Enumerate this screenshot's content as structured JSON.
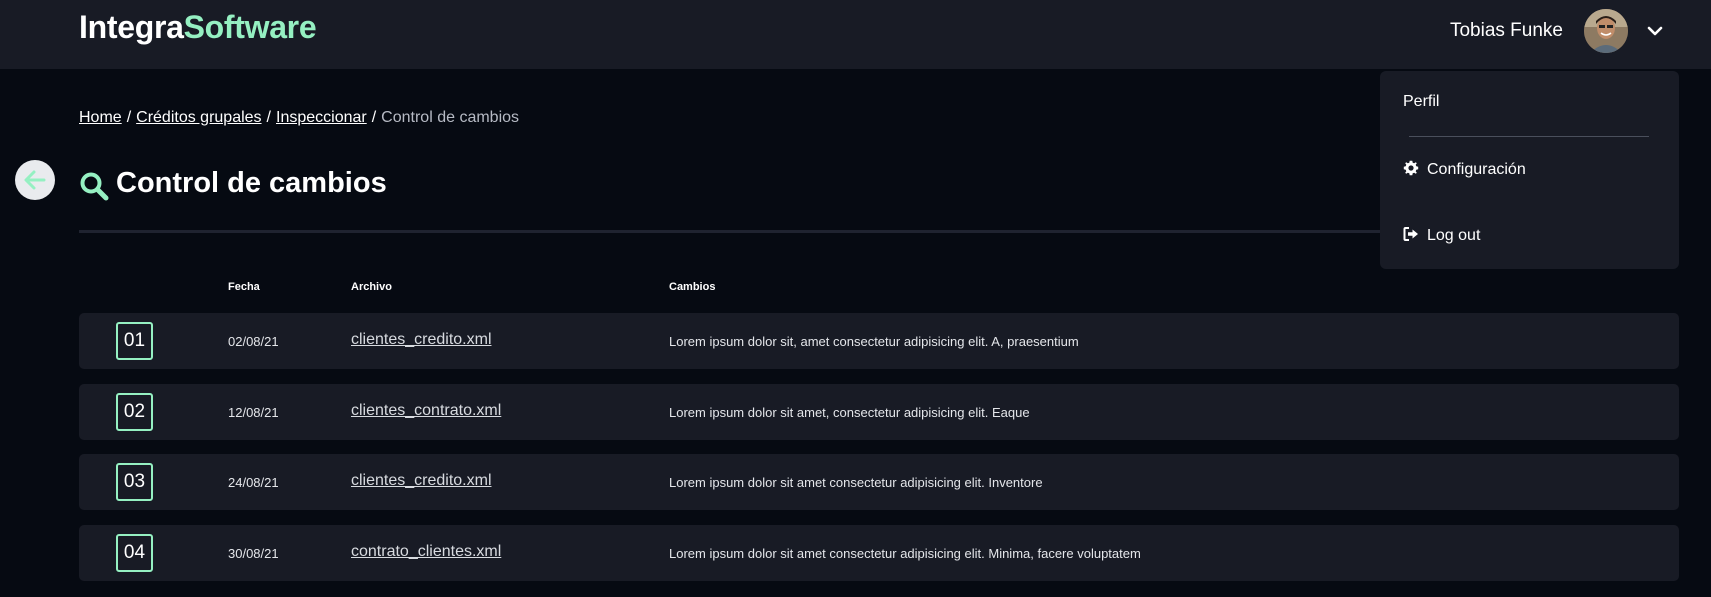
{
  "header": {
    "logo_part1": "Integra",
    "logo_part2": "Software",
    "user_name": "Tobias Funke"
  },
  "breadcrumb": {
    "items": [
      "Home",
      "Créditos grupales",
      "Inspeccionar"
    ],
    "current": "Control de cambios",
    "separator": "/"
  },
  "page": {
    "title": "Control de cambios"
  },
  "table": {
    "headers": {
      "fecha": "Fecha",
      "archivo": "Archivo",
      "cambios": "Cambios"
    },
    "rows": [
      {
        "num": "01",
        "fecha": "02/08/21",
        "archivo": "clientes_credito.xml",
        "cambios": "Lorem ipsum dolor sit, amet consectetur adipisicing elit. A, praesentium"
      },
      {
        "num": "02",
        "fecha": "12/08/21",
        "archivo": "clientes_contrato.xml",
        "cambios": "Lorem ipsum dolor sit amet, consectetur adipisicing elit. Eaque"
      },
      {
        "num": "03",
        "fecha": "24/08/21",
        "archivo": "clientes_credito.xml",
        "cambios": "Lorem ipsum dolor sit amet consectetur adipisicing elit. Inventore"
      },
      {
        "num": "04",
        "fecha": "30/08/21",
        "archivo": "contrato_clientes.xml",
        "cambios": "Lorem ipsum dolor sit amet consectetur adipisicing elit. Minima, facere voluptatem"
      }
    ]
  },
  "user_menu": {
    "perfil": "Perfil",
    "configuracion": "Configuración",
    "logout": "Log out"
  },
  "icons": {
    "back": "arrow-left-icon",
    "title": "search-icon",
    "menu_toggle": "chevron-down-icon",
    "settings": "gear-icon",
    "logout": "logout-icon"
  },
  "colors": {
    "accent": "#95f0c2",
    "background": "#060a12",
    "surface": "#181b25"
  }
}
